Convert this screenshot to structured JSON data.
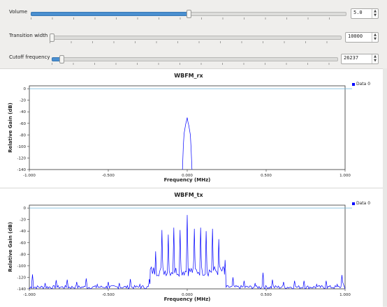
{
  "controls": {
    "volume": {
      "label": "Volume",
      "value": "5.0",
      "fill_fraction": 0.5
    },
    "transition": {
      "label": "Transition width",
      "value": "10000",
      "fill_fraction": 0.0
    },
    "cutoff": {
      "label": "Cutoff frequency",
      "value": "26237",
      "fill_fraction": 0.035
    }
  },
  "plots": [
    {
      "title": "WBFM_rx",
      "xlabel": "Frequency (MHz)",
      "ylabel": "Relative Gain (dB)",
      "legend": "Data 0"
    },
    {
      "title": "WBFM_tx",
      "xlabel": "Frequency (MHz)",
      "ylabel": "Relative Gain (dB)",
      "legend": "Data 0"
    }
  ],
  "chart_data": [
    {
      "type": "line",
      "title": "WBFM_rx",
      "xlabel": "Frequency (MHz)",
      "ylabel": "Relative Gain (dB)",
      "xlim": [
        -1.0,
        1.0
      ],
      "ylim": [
        -140,
        5
      ],
      "xticks": [
        "-1.000",
        "-0.500",
        "0.000",
        "0.500",
        "1.000"
      ],
      "yticks": [
        "0",
        "-20",
        "-40",
        "-60",
        "-80",
        "-100",
        "-120",
        "-140"
      ],
      "reference_line_db": 0,
      "series": [
        {
          "name": "Data 0",
          "color": "#0000ff",
          "x": [
            -0.03,
            -0.025,
            -0.02,
            -0.015,
            -0.01,
            -0.005,
            0.0,
            0.005,
            0.01,
            0.015,
            0.02,
            0.025,
            0.03
          ],
          "y": [
            -140,
            -100,
            -78,
            -70,
            -62,
            -56,
            -50,
            -58,
            -64,
            -72,
            -80,
            -105,
            -140
          ]
        }
      ]
    },
    {
      "type": "line",
      "title": "WBFM_tx",
      "xlabel": "Frequency (MHz)",
      "ylabel": "Relative Gain (dB)",
      "xlim": [
        -1.0,
        1.0
      ],
      "ylim": [
        -140,
        5
      ],
      "xticks": [
        "-1.000",
        "-0.500",
        "0.000",
        "0.500",
        "1.000"
      ],
      "yticks": [
        "0",
        "-20",
        "-40",
        "-60",
        "-80",
        "-100",
        "-120",
        "-140"
      ],
      "reference_line_db": 0,
      "series": [
        {
          "name": "Data 0",
          "color": "#0000ff",
          "noise_floor_db": -140,
          "peaks": [
            {
              "x": -0.98,
              "y": -115
            },
            {
              "x": -0.9,
              "y": -130
            },
            {
              "x": -0.83,
              "y": -125
            },
            {
              "x": -0.76,
              "y": -124
            },
            {
              "x": -0.7,
              "y": -128
            },
            {
              "x": -0.64,
              "y": -122
            },
            {
              "x": -0.57,
              "y": -132
            },
            {
              "x": -0.5,
              "y": -128
            },
            {
              "x": -0.43,
              "y": -130
            },
            {
              "x": -0.36,
              "y": -123
            },
            {
              "x": -0.3,
              "y": -132
            },
            {
              "x": -0.24,
              "y": -123
            },
            {
              "x": -0.2,
              "y": -75
            },
            {
              "x": -0.16,
              "y": -38
            },
            {
              "x": -0.12,
              "y": -46
            },
            {
              "x": -0.085,
              "y": -34
            },
            {
              "x": -0.045,
              "y": -38
            },
            {
              "x": 0.0,
              "y": -12
            },
            {
              "x": 0.045,
              "y": -36
            },
            {
              "x": 0.085,
              "y": -34
            },
            {
              "x": 0.12,
              "y": -40
            },
            {
              "x": 0.16,
              "y": -36
            },
            {
              "x": 0.2,
              "y": -54
            },
            {
              "x": 0.24,
              "y": -90
            },
            {
              "x": 0.29,
              "y": -120
            },
            {
              "x": 0.36,
              "y": -126
            },
            {
              "x": 0.43,
              "y": -130
            },
            {
              "x": 0.48,
              "y": -112
            },
            {
              "x": 0.54,
              "y": -124
            },
            {
              "x": 0.61,
              "y": -128
            },
            {
              "x": 0.68,
              "y": -126
            },
            {
              "x": 0.74,
              "y": -126
            },
            {
              "x": 0.82,
              "y": -132
            },
            {
              "x": 0.88,
              "y": -126
            },
            {
              "x": 0.95,
              "y": -132
            },
            {
              "x": 0.98,
              "y": -116
            }
          ]
        }
      ]
    }
  ]
}
